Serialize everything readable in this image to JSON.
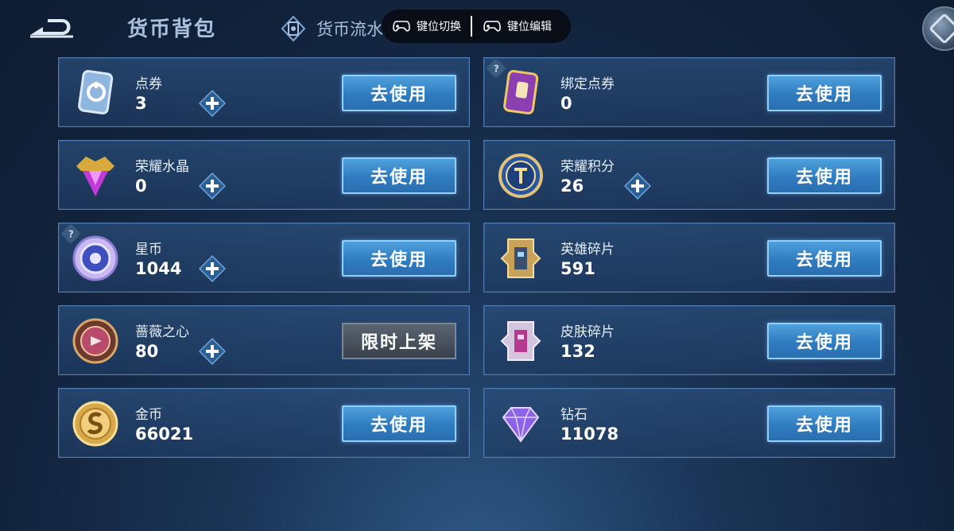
{
  "header": {
    "title": "货币背包",
    "flow_tab": "货币流水",
    "overlay": {
      "left_label": "键位切换",
      "right_label": "键位编辑"
    }
  },
  "items": [
    {
      "name": "点券",
      "count": "3",
      "action": "去使用"
    },
    {
      "name": "绑定点券",
      "count": "0",
      "action": "去使用"
    },
    {
      "name": "荣耀水晶",
      "count": "0",
      "action": "去使用"
    },
    {
      "name": "荣耀积分",
      "count": "26",
      "action": "去使用"
    },
    {
      "name": "星币",
      "count": "1044",
      "action": "去使用"
    },
    {
      "name": "英雄碎片",
      "count": "591",
      "action": "去使用"
    },
    {
      "name": "蔷薇之心",
      "count": "80",
      "action": "限时上架"
    },
    {
      "name": "皮肤碎片",
      "count": "132",
      "action": "去使用"
    },
    {
      "name": "金币",
      "count": "66021",
      "action": "去使用"
    },
    {
      "name": "钻石",
      "count": "11078",
      "action": "去使用"
    }
  ],
  "help_mark": "?",
  "colors": {
    "accent_button": "#2f7cc0",
    "disabled_button": "#39414c",
    "card_border": "#4e7bb0",
    "background": "#12233d"
  }
}
